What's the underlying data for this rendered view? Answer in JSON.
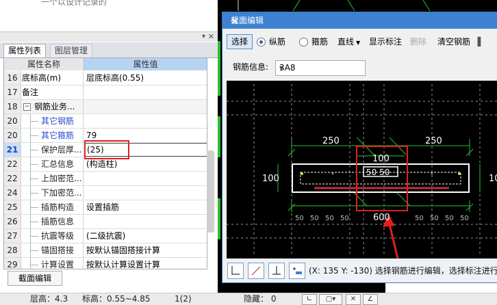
{
  "top_strip_text": "一个以设计记录的",
  "tabs": [
    "属性列表",
    "图层管理"
  ],
  "headers": {
    "name": "属性名称",
    "value": "属性值"
  },
  "rows": [
    {
      "no": "16",
      "name": "底标高(m)",
      "value": "层底标高(0.55)"
    },
    {
      "no": "17",
      "name": "备注",
      "value": ""
    },
    {
      "no": "18",
      "name": "钢筋业务...",
      "value": ""
    },
    {
      "no": "20",
      "name": "其它钢筋",
      "value": ""
    },
    {
      "no": "20",
      "name": "其它箍筋",
      "value": "79"
    },
    {
      "no": "21",
      "name": "保护层厚...",
      "value": "(25)"
    },
    {
      "no": "22",
      "name": "汇总信息",
      "value": "(构造柱)"
    },
    {
      "no": "22",
      "name": "上加密范...",
      "value": ""
    },
    {
      "no": "24",
      "name": "下加密范...",
      "value": ""
    },
    {
      "no": "25",
      "name": "插筋构造",
      "value": "设置插筋"
    },
    {
      "no": "26",
      "name": "插筋信息",
      "value": ""
    },
    {
      "no": "27",
      "name": "抗震等级",
      "value": "(二级抗震)"
    },
    {
      "no": "28",
      "name": "锚固搭接",
      "value": "按默认锚固搭接计算"
    },
    {
      "no": "29",
      "name": "计算设置",
      "value": "按默认计算设置计算"
    }
  ],
  "collapse_symbol": "−",
  "edit_button": "截面编辑",
  "status": {
    "floor_height": "层高：4.3",
    "elevation": "标高：0.55~4.85",
    "count": "1(2)",
    "hidden": "隐藏： 0"
  },
  "dialog": {
    "title": "截面编辑",
    "toolbar": {
      "select": "选择",
      "longitudinal": "纵筋",
      "stirrup": "箍筋",
      "line": "直线",
      "show_label": "显示标注",
      "delete": "删除",
      "clear": "清空钢筋"
    },
    "rebar_label": "钢筋信息:",
    "rebar_value": "3A8",
    "canvas": {
      "dim_left": "250",
      "dim_right": "250",
      "dim_top_center": "100",
      "dim_left_height": "100",
      "dim_right_height": "10",
      "dim_inner": "50 50",
      "dim_bottom": "600",
      "tiny_label": "50"
    },
    "coord_text": "(X: 135 Y: -130) 选择钢筋进行编辑，选择标注进行"
  },
  "colors": {
    "accent": "#3d82d0",
    "highlight_box": "#e02020",
    "dim_green": "#2fbf2f",
    "rebar_red": "#c0303a"
  }
}
